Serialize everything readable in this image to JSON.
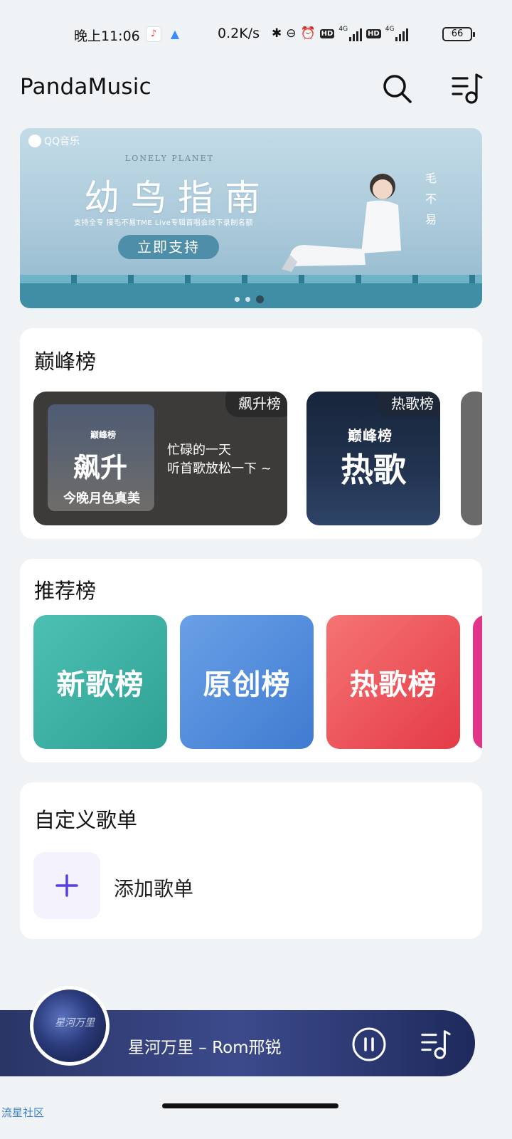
{
  "status_bar": {
    "time": "晚上11:06",
    "speed": "0.2K/s",
    "hd1": "HD",
    "net1": "4G",
    "hd2": "HD",
    "net2": "4G",
    "battery": "66"
  },
  "header": {
    "title": "PandaMusic",
    "search_icon": "search-icon",
    "queue_icon": "music-queue-icon"
  },
  "banner": {
    "logo": "QQ音乐",
    "subtitle_en": "LONELY PLANET",
    "title": "幼鸟指南",
    "description": "支持全专 接毛不易TME Live专辑首唱会线下录制名额",
    "cta": "立即支持",
    "side_text": "毛不易",
    "dots_count": 3,
    "active_dot": 2
  },
  "peak": {
    "title": "巅峰榜",
    "items": [
      {
        "tag": "飙升榜",
        "cover_small": "巅峰榜",
        "cover_big": "飙升",
        "cover_foot": "今晚月色真美",
        "desc_line1": "忙碌的一天",
        "desc_line2": "听首歌放松一下 ~"
      },
      {
        "tag": "热歌榜",
        "cover_small": "巅峰榜",
        "cover_big": "热歌"
      }
    ]
  },
  "recommend": {
    "title": "推荐榜",
    "items": [
      "新歌榜",
      "原创榜",
      "热歌榜"
    ]
  },
  "custom": {
    "title": "自定义歌单",
    "add_label": "添加歌单"
  },
  "player": {
    "song": "星河万里 – Rom邢锐",
    "art_text": "星河万里",
    "state": "playing"
  },
  "watermark": "流星社区"
}
